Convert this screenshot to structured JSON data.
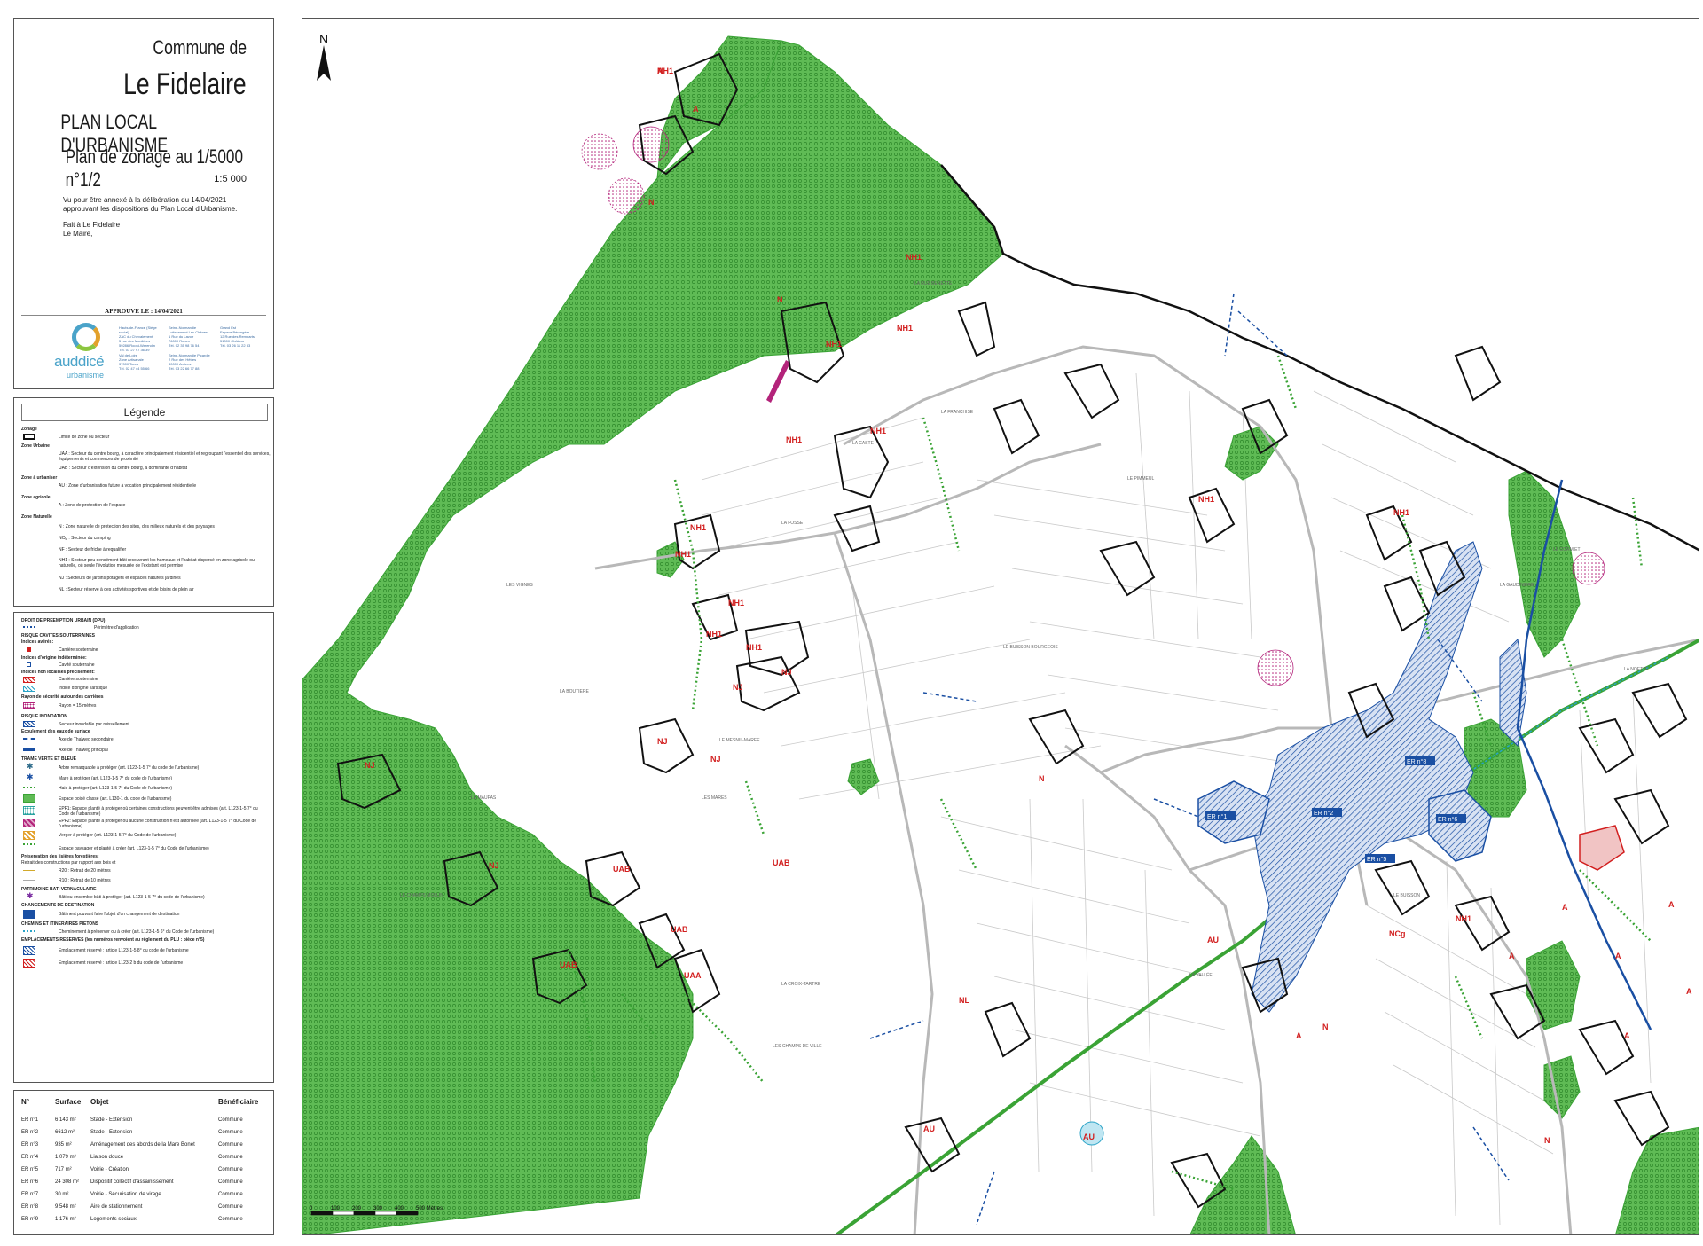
{
  "title_block": {
    "commune_label": "Commune de",
    "commune_name": "Le Fidelaire",
    "document": "PLAN LOCAL D'URBANISME",
    "plan_title": "Plan de zonage au 1/5000 n°1/2",
    "scale": "1:5 000",
    "vu_text": "Vu pour être annexé à la délibération du 14/04/2021 approuvant les dispositions du Plan Local d'Urbanisme.",
    "fait_text": "Fait à Le Fidelaire",
    "maire_text": "Le Maire,",
    "approuve": "APPROUVE LE : 14/04/2021",
    "logo_name": "auddicé",
    "logo_sub": "urbanisme",
    "logo_url_text": "auddice.com"
  },
  "legend": {
    "title": "Légende",
    "zonage_header": "Zonage",
    "zonage_limit": "Limite de zone ou secteur",
    "urbaine_header": "Zone Urbaine",
    "uaa": "UAA : Secteur du centre bourg, à caractère principalement résidentiel et regroupant l'essentiel des services, équipements et commerces de proximité",
    "uab": "UAB : Secteur d'extension du centre bourg, à dominante d'habitat",
    "aurbaniser_header": "Zone à urbaniser",
    "au": "AU : Zone d'urbanisation future à vocation principalement résidentielle",
    "agricole_header": "Zone agricole",
    "a": "A : Zone de protection de l'espace",
    "naturelle_header": "Zone Naturelle",
    "n": "N : Zone naturelle de protection des sites, des milieux naturels et des paysages",
    "ncg": "NCg : Secteur du camping",
    "nf": "NF : Secteur de friche à requalifier",
    "nh1": "NH1 : Secteur peu densément bâti recouvrant les hameaux et l'habitat dispersé en zone agricole ou naturelle, où seule l'évolution mesurée de l'existant est permise",
    "nj": "NJ : Secteurs de jardins potagers et espaces naturels jardinés",
    "nl": "NL : Secteur réservé à des activités sportives et de loisirs de plein air"
  },
  "legend2": {
    "dpu_header": "DROIT DE PREEMPTION URBAIN (DPU)",
    "dpu": "Périmètre d'application",
    "cavites_header": "RISQUE CAVITES SOUTERRAINES",
    "indices_averes": "Indices avérés:",
    "carriere": "Carrière souterraine",
    "indices_inc": "Indices d'origine indéterminée:",
    "cavite": "Cavité souterraine",
    "indices_non": "Indices non localisés précisément:",
    "carriere2": "Carrière souterraine",
    "karstique": "Indice d'origine karstique",
    "rayon_header": "Rayon de sécurité autour des carrières",
    "rayon": "Rayon = 15 mètres",
    "inondation_header": "RISQUE INONDATION",
    "inondable": "Secteur inondable par ruissellement",
    "ecoulement_header": "Ecoulement des eaux de surface",
    "thalweg2": "Axe de Thalweg secondaire",
    "thalweg1": "Axe de Thalweg principal",
    "tvb_header": "TRAME VERTE ET BLEUE",
    "arbre": "Arbre remarquable à protéger (art. L123-1-5 7° du code de l'urbanisme)",
    "mare": "Mare à protéger (art. L123-1-5 7° du code de l'urbanisme)",
    "haie": "Haie à protéger (art. L123-1-5 7° du Code de l'urbanisme)",
    "ebc": "Espace boisé classé (art. L130-1 du code de l'urbanisme)",
    "epf1": "EPF1: Espace planté à protéger où certaines constructions peuvent être admises (art. L123-1-5 7° du Code de l'urbanisme)",
    "epf2": "EPF2: Espace planté à protéger où aucune construction n'est autorisée (art. L123-1-5 7° du Code de l'urbanisme)",
    "verger": "Verger à protéger (art. L123-1-5 7° du Code de l'urbanisme)",
    "paysager": "Espace paysager et planté à créer (art. L123-1-5 7° du Code de l'urbanisme)",
    "lisieres_header": "Préservation des lisières forestières:",
    "lisieres_sub": "Retrait des constructions par rapport aux bois et",
    "r20": "R20 : Retrait de 20 mètres",
    "r10": "R10 : Retrait de 10 mètres",
    "patrimoine_header": "PATRIMOINE BATI VERNACULAIRE",
    "bati": "Bâti ou ensemble bâti à protéger (art. L123-1-5 7° du code de l'urbanisme)",
    "changement_header": "CHANGEMENTS DE DESTINATION",
    "batiment": "Bâtiment pouvant faire l'objet d'un changement de destination",
    "chemins_header": "CHEMINS ET ITINERAIRES PIETONS",
    "cheminement": "Cheminement à préserver ou à créer (art. L123-1-5 6° du Code de l'urbanisme)",
    "er_header": "EMPLACEMENTS RESERVES (les numéros renvoient au règlement du PLU : pièce n°5)",
    "er1": "Emplacement réservé : article L123-1-5 8° du code de l'urbanisme",
    "er2": "Emplacement réservé : article L123-2 b du code de l'urbanisme"
  },
  "er_table": {
    "headers": [
      "N°",
      "Surface",
      "Objet",
      "Bénéficiaire"
    ],
    "rows": [
      [
        "ER n°1",
        "6 143 m²",
        "Stade - Extension",
        "Commune"
      ],
      [
        "ER n°2",
        "6612 m²",
        "Stade - Extension",
        "Commune"
      ],
      [
        "ER n°3",
        "935 m²",
        "Aménagement des abords de la Mare Bonet",
        "Commune"
      ],
      [
        "ER n°4",
        "1 079 m²",
        "Liaison douce",
        "Commune"
      ],
      [
        "ER n°5",
        "717 m²",
        "Voirie - Création",
        "Commune"
      ],
      [
        "ER n°6",
        "24 308 m²",
        "Dispositif collectif d'assainissement",
        "Commune"
      ],
      [
        "ER n°7",
        "30 m²",
        "Voirie - Sécurisation de virage",
        "Commune"
      ],
      [
        "ER n°8",
        "9 548 m²",
        "Aire de stationnement",
        "Commune"
      ],
      [
        "ER n°9",
        "1 176 m²",
        "Logements sociaux",
        "Commune"
      ]
    ]
  },
  "map": {
    "north": "N",
    "scalebar_labels": [
      "0",
      "100",
      "200",
      "300",
      "400",
      "500 Mètres"
    ],
    "zone_labels": [
      "A",
      "A",
      "N",
      "N",
      "NH1",
      "NH1",
      "NH1",
      "NH1",
      "NH1",
      "NH1",
      "NH1",
      "NH1",
      "NH1",
      "NH1",
      "NJ",
      "NJ",
      "NJ",
      "NJ",
      "NJ",
      "NJ",
      "UAB",
      "UAB",
      "UAB",
      "UAB",
      "UAA",
      "AU",
      "AU",
      "AU",
      "NL",
      "NCg",
      "NH1",
      "A",
      "A",
      "A",
      "A",
      "A",
      "A",
      "A",
      "N",
      "N",
      "N",
      "NH1",
      "NH1",
      "NH1"
    ],
    "er_labels": [
      "ER n°1",
      "ER n°2",
      "ER n°5",
      "ER n°6",
      "ER n°8"
    ],
    "place_names": [
      "LA RUE BENETTE",
      "LA FRANCHISE",
      "LA CASTE",
      "LA FOSSE",
      "LE BUISSON BOURGEOIS",
      "LES VIGNES",
      "LE MAUPAS",
      "LA BOUTIERE",
      "LE MESNIL-MAREE",
      "LES MARES",
      "LE CHAMPS MOLLIN",
      "LA CROIX-TARTRE",
      "LES CHAMPS DE VILLE",
      "LA VALLÉE",
      "LE BUISSON",
      "LA GAUDINIERE",
      "LE CORMIET",
      "LA NOETTE",
      "LE PIMMEUL"
    ],
    "colors": {
      "green": "#3aa335",
      "green_fill": "#5fbb55",
      "zone_line": "#111111",
      "label_red": "#d21f1f",
      "er_blue": "#1a4fa3",
      "hedge": "#3aa335",
      "cavity": "#b3237a"
    }
  }
}
